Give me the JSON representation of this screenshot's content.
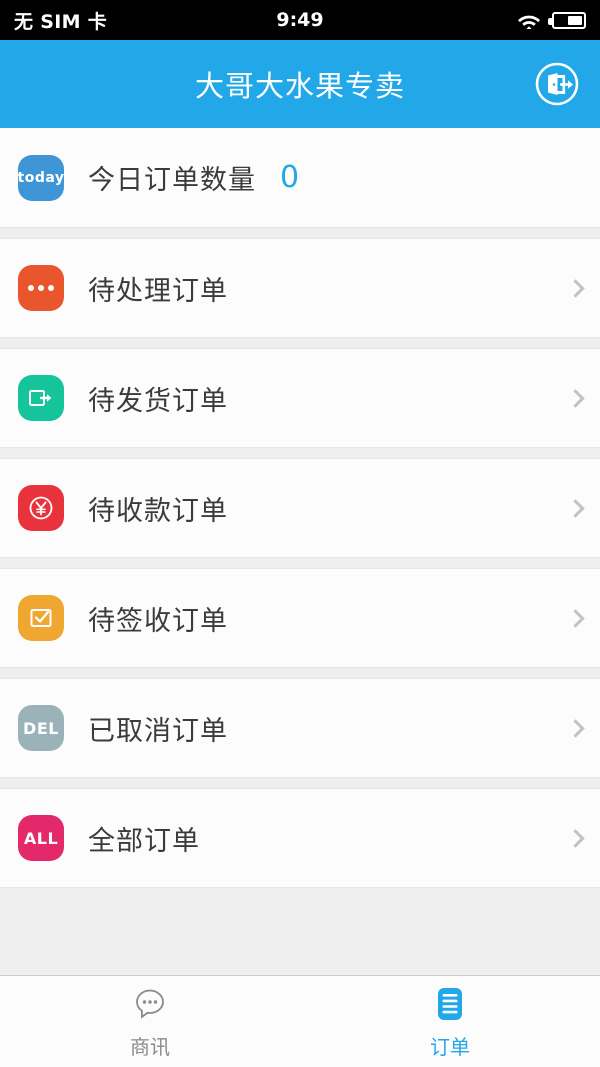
{
  "status_bar": {
    "carrier": "无 SIM 卡",
    "time": "9:49",
    "wifi_icon": "wifi-icon",
    "battery_icon": "battery-icon",
    "battery_level_pct": 55
  },
  "header": {
    "title": "大哥大水果专卖",
    "action_icon": "logout-door-icon",
    "background_color": "#22a8e8"
  },
  "list": {
    "rows": [
      {
        "icon_name": "today-icon",
        "icon_label": "today",
        "icon_color": "#3f96d7",
        "label": "今日订单数量",
        "count": "0",
        "has_chevron": false
      },
      {
        "icon_name": "pending-dots-icon",
        "icon_label": "",
        "icon_color": "#e9552c",
        "label": "待处理订单",
        "count": "",
        "has_chevron": true
      },
      {
        "icon_name": "ship-out-icon",
        "icon_label": "",
        "icon_color": "#16c49b",
        "label": "待发货订单",
        "count": "",
        "has_chevron": true
      },
      {
        "icon_name": "yuan-payment-icon",
        "icon_label": "",
        "icon_color": "#e8333d",
        "label": "待收款订单",
        "count": "",
        "has_chevron": true
      },
      {
        "icon_name": "signed-receipt-icon",
        "icon_label": "",
        "icon_color": "#f0a732",
        "label": "待签收订单",
        "count": "",
        "has_chevron": true
      },
      {
        "icon_name": "cancelled-icon",
        "icon_label": "DEL",
        "icon_color": "#9bb3b8",
        "label": "已取消订单",
        "count": "",
        "has_chevron": true
      },
      {
        "icon_name": "all-orders-icon",
        "icon_label": "ALL",
        "icon_color": "#e4296a",
        "label": "全部订单",
        "count": "",
        "has_chevron": true
      }
    ]
  },
  "tab_bar": {
    "tabs": [
      {
        "label": "商讯",
        "icon_name": "chat-bubble-icon",
        "active": false,
        "color": "#8a8a8a"
      },
      {
        "label": "订单",
        "icon_name": "order-list-icon",
        "active": true,
        "color": "#22a8e8"
      }
    ]
  }
}
